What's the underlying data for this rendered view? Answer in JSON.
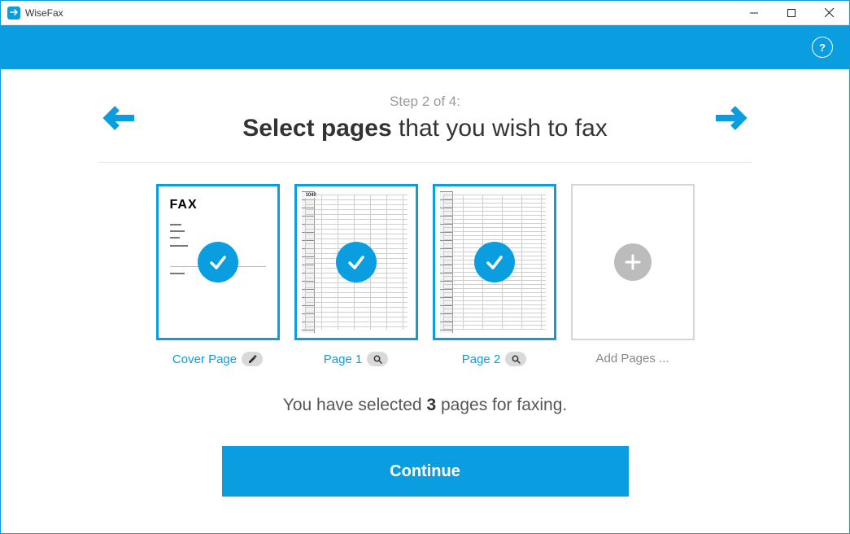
{
  "window": {
    "title": "WiseFax"
  },
  "header": {
    "help_tooltip": "?"
  },
  "wizard": {
    "step_label": "Step 2 of 4:",
    "title_bold": "Select pages",
    "title_rest": " that you wish to fax"
  },
  "pages": {
    "cover": {
      "label": "Cover Page",
      "doc_title": "FAX"
    },
    "p1": {
      "label": "Page 1",
      "form_number": "1040"
    },
    "p2": {
      "label": "Page 2"
    },
    "add": {
      "label": "Add Pages ..."
    }
  },
  "summary": {
    "prefix": "You have selected ",
    "count": "3",
    "suffix": " pages for faxing."
  },
  "actions": {
    "continue": "Continue"
  }
}
